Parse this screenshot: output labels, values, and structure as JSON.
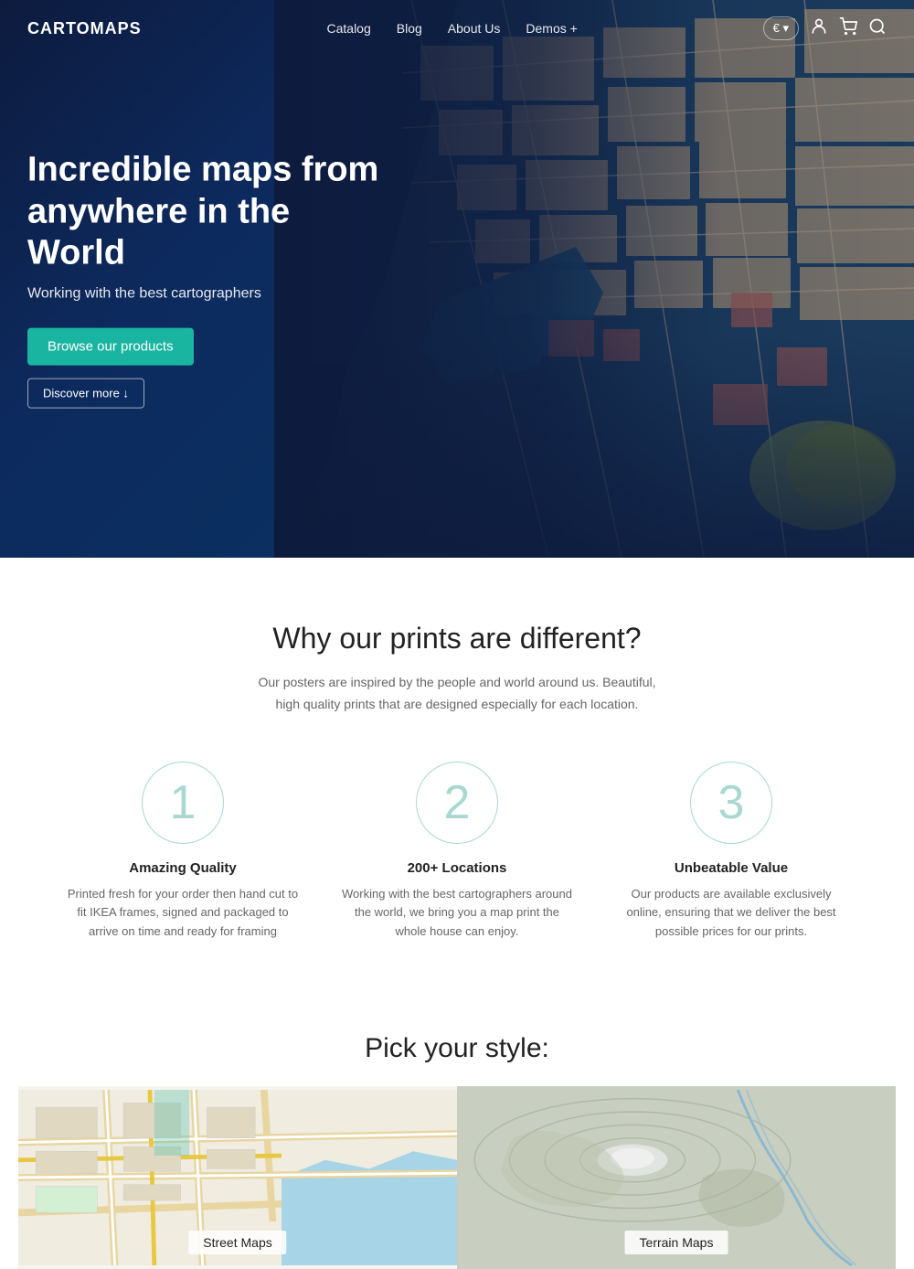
{
  "nav": {
    "logo": "CARTOMAPS",
    "links": [
      {
        "label": "Catalog",
        "id": "catalog"
      },
      {
        "label": "Blog",
        "id": "blog"
      },
      {
        "label": "About Us",
        "id": "about"
      },
      {
        "label": "Demos +",
        "id": "demos"
      }
    ],
    "currency": "€ ▾",
    "icons": {
      "account": "👤",
      "cart": "🛒",
      "search": "🔍"
    }
  },
  "hero": {
    "title": "Incredible maps from anywhere in the World",
    "subtitle": "Working with the best cartographers",
    "cta_primary": "Browse our products",
    "cta_secondary": "Discover more ↓"
  },
  "why": {
    "title": "Why our prints are different?",
    "description": "Our posters are inspired by the people and world around us. Beautiful, high quality prints that are designed especially for each location.",
    "features": [
      {
        "number": "1",
        "title": "Amazing Quality",
        "description": "Printed fresh for your order then hand cut to fit IKEA frames, signed and packaged to arrive on time and ready for framing"
      },
      {
        "number": "2",
        "title": "200+ Locations",
        "description": "Working with the best cartographers around the world, we bring you a map print the whole house can enjoy."
      },
      {
        "number": "3",
        "title": "Unbeatable Value",
        "description": "Our products are available exclusively online, ensuring that we deliver the best possible prices for our prints."
      }
    ]
  },
  "pick": {
    "title": "Pick your style:",
    "cards": [
      {
        "label": "Street Maps",
        "type": "street"
      },
      {
        "label": "Terrain Maps",
        "type": "terrain"
      }
    ]
  }
}
